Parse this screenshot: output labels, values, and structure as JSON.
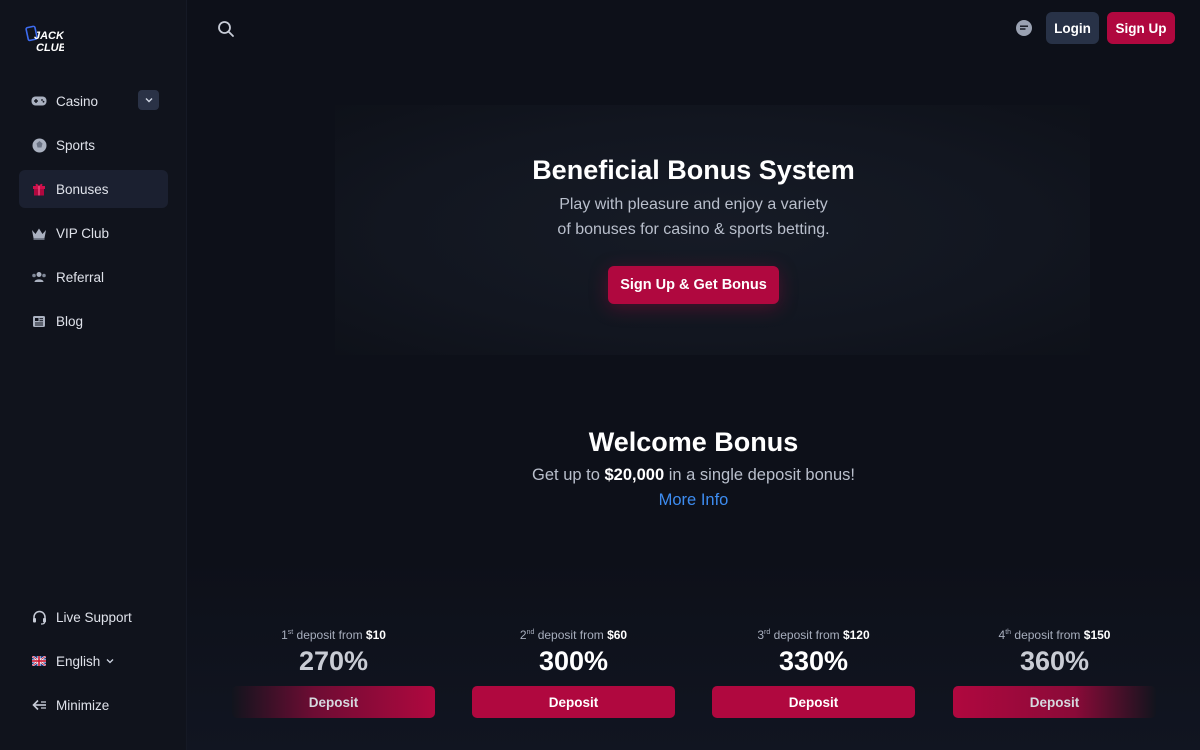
{
  "brand": {
    "logo_alt": "Jacks Club",
    "accent": "#b0083f",
    "link_color": "#3d8cf0"
  },
  "sidebar": {
    "items": [
      {
        "label": "Casino",
        "icon": "gamepad-icon",
        "active": false,
        "expandable": true
      },
      {
        "label": "Sports",
        "icon": "ball-icon",
        "active": false
      },
      {
        "label": "Bonuses",
        "icon": "gift-icon",
        "active": true
      },
      {
        "label": "VIP Club",
        "icon": "crown-icon",
        "active": false
      },
      {
        "label": "Referral",
        "icon": "users-icon",
        "active": false
      },
      {
        "label": "Blog",
        "icon": "newspaper-icon",
        "active": false
      }
    ],
    "bottom": [
      {
        "label": "Live Support",
        "icon": "headset-icon"
      },
      {
        "label": "English",
        "icon": "uk-flag-icon"
      },
      {
        "label": "Minimize",
        "icon": "arrow-left-icon"
      }
    ]
  },
  "header": {
    "login_label": "Login",
    "signup_label": "Sign Up"
  },
  "hero": {
    "title": "Beneficial Bonus System",
    "subtitle_line1": "Play with pleasure and enjoy a variety",
    "subtitle_line2": "of bonuses for casino & sports betting.",
    "cta_label": "Sign Up & Get Bonus"
  },
  "welcome": {
    "title": "Welcome Bonus",
    "sub_prefix": "Get up to ",
    "sub_amount": "$20,000",
    "sub_suffix": " in a single deposit bonus!",
    "more_info": "More Info"
  },
  "deposits": [
    {
      "ordinal": "1",
      "suffix": "st",
      "label": " deposit from ",
      "min": "$10",
      "percent": "270%",
      "button": "Deposit"
    },
    {
      "ordinal": "2",
      "suffix": "nd",
      "label": " deposit from ",
      "min": "$60",
      "percent": "300%",
      "button": "Deposit"
    },
    {
      "ordinal": "3",
      "suffix": "rd",
      "label": " deposit from ",
      "min": "$120",
      "percent": "330%",
      "button": "Deposit"
    },
    {
      "ordinal": "4",
      "suffix": "th",
      "label": " deposit from ",
      "min": "$150",
      "percent": "360%",
      "button": "Deposit"
    }
  ]
}
